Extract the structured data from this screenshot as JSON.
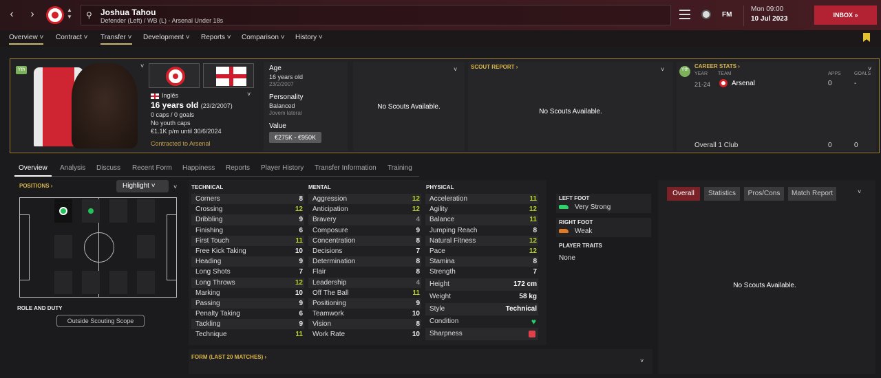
{
  "player": {
    "name": "Joshua Tahou",
    "subtitle": "Defender (Left) / WB (L) - Arsenal Under 18s",
    "nationality": "Inglês",
    "age_line": "16 years old",
    "dob_paren": "(23/2/2007)",
    "caps": "0 caps / 0 goals",
    "youth_caps": "No youth caps",
    "wage": "€1.1K p/m until 30/6/2024",
    "contract": "Contracted to Arsenal",
    "yth_badge": "Yth"
  },
  "topbar": {
    "time": "Mon 09:00",
    "date": "10 Jul 2023",
    "inbox": "INBOX",
    "fm": "FM"
  },
  "menu": [
    "Overview",
    "Contract",
    "Transfer",
    "Development",
    "Reports",
    "Comparison",
    "History"
  ],
  "profile": {
    "age_label": "Age",
    "age_value": "16 years old",
    "age_dob": "23/2/2007",
    "personality_label": "Personality",
    "personality_value": "Balanced",
    "personality_sub": "Jovem lateral",
    "value_label": "Value",
    "value_range": "€275K - €950K",
    "no_scouts_1": "No Scouts Available.",
    "scout_report": "SCOUT REPORT",
    "no_scouts_2": "No Scouts Available."
  },
  "career": {
    "title": "CAREER STATS",
    "col_year": "YEAR",
    "col_team": "TEAM",
    "col_apps": "APPS",
    "col_goals": "GOALS",
    "row_year": "21-24",
    "row_team": "Arsenal",
    "row_apps": "0",
    "row_goals": "-",
    "overall_label": "Overall 1 Club",
    "overall_apps": "0",
    "overall_goals": "0"
  },
  "tabs": [
    "Overview",
    "Analysis",
    "Discuss",
    "Recent Form",
    "Happiness",
    "Reports",
    "Player History",
    "Transfer Information",
    "Training"
  ],
  "positions": {
    "title": "POSITIONS",
    "highlight": "Highlight",
    "role_duty": "ROLE AND DUTY",
    "outside_scope": "Outside Scouting Scope"
  },
  "attributes": {
    "technical_title": "TECHNICAL",
    "mental_title": "MENTAL",
    "physical_title": "PHYSICAL",
    "technical": [
      {
        "name": "Corners",
        "value": "8"
      },
      {
        "name": "Crossing",
        "value": "12"
      },
      {
        "name": "Dribbling",
        "value": "9"
      },
      {
        "name": "Finishing",
        "value": "6"
      },
      {
        "name": "First Touch",
        "value": "11"
      },
      {
        "name": "Free Kick Taking",
        "value": "10"
      },
      {
        "name": "Heading",
        "value": "9"
      },
      {
        "name": "Long Shots",
        "value": "7"
      },
      {
        "name": "Long Throws",
        "value": "12"
      },
      {
        "name": "Marking",
        "value": "10"
      },
      {
        "name": "Passing",
        "value": "9"
      },
      {
        "name": "Penalty Taking",
        "value": "6"
      },
      {
        "name": "Tackling",
        "value": "9"
      },
      {
        "name": "Technique",
        "value": "11"
      }
    ],
    "mental": [
      {
        "name": "Aggression",
        "value": "12"
      },
      {
        "name": "Anticipation",
        "value": "12"
      },
      {
        "name": "Bravery",
        "value": "4"
      },
      {
        "name": "Composure",
        "value": "9"
      },
      {
        "name": "Concentration",
        "value": "8"
      },
      {
        "name": "Decisions",
        "value": "7"
      },
      {
        "name": "Determination",
        "value": "8"
      },
      {
        "name": "Flair",
        "value": "8"
      },
      {
        "name": "Leadership",
        "value": "4"
      },
      {
        "name": "Off The Ball",
        "value": "11"
      },
      {
        "name": "Positioning",
        "value": "9"
      },
      {
        "name": "Teamwork",
        "value": "10"
      },
      {
        "name": "Vision",
        "value": "8"
      },
      {
        "name": "Work Rate",
        "value": "10"
      }
    ],
    "physical": [
      {
        "name": "Acceleration",
        "value": "11"
      },
      {
        "name": "Agility",
        "value": "12"
      },
      {
        "name": "Balance",
        "value": "11"
      },
      {
        "name": "Jumping Reach",
        "value": "8"
      },
      {
        "name": "Natural Fitness",
        "value": "12"
      },
      {
        "name": "Pace",
        "value": "12"
      },
      {
        "name": "Stamina",
        "value": "8"
      },
      {
        "name": "Strength",
        "value": "7"
      }
    ],
    "extra": [
      {
        "name": "Height",
        "value": "172 cm"
      },
      {
        "name": "Weight",
        "value": "58 kg"
      },
      {
        "name": "Style",
        "value": "Technical"
      },
      {
        "name": "Condition",
        "value": ""
      },
      {
        "name": "Sharpness",
        "value": ""
      }
    ]
  },
  "feet": {
    "left_label": "LEFT FOOT",
    "left_value": "Very Strong",
    "right_label": "RIGHT FOOT",
    "right_value": "Weak",
    "traits_label": "PLAYER TRAITS",
    "traits_value": "None"
  },
  "right": {
    "tabs": [
      "Overall",
      "Statistics",
      "Pros/Cons",
      "Match Report"
    ],
    "no_scouts": "No Scouts Available."
  },
  "form": {
    "title": "FORM (LAST 20 MATCHES)"
  }
}
